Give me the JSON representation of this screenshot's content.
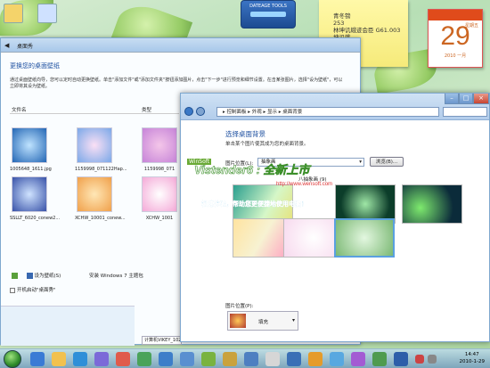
{
  "gadgets": {
    "note_lines": [
      "青冬镑",
      "253",
      "林坤讥蛾迹会臣 G61.003",
      "坤讥蛾",
      "57CAG"
    ],
    "calendar": {
      "weekday": "星期五",
      "day": "29",
      "year_month": "2010 一月"
    },
    "meter_label": "DATEAGE TOOLS"
  },
  "back_window": {
    "title": "桌面秀",
    "subtitle": "更换您的桌面壁纸",
    "description": "通过桌面壁纸向导，您可以定时自动更换壁纸。单击\"添加文件\"或\"添加文件夹\"按钮添加图片，点击\"下一步\"进行预览和细节设置。在击某张图片，选择\"设为壁纸\"，可以立即将其设为壁纸。",
    "columns": [
      "文件名",
      "类型"
    ],
    "files_row1": [
      "1005648_1611.jpg",
      "1159998_071122Hap...",
      "1159998_071"
    ],
    "files_row2": [
      "SSLLT_6020_conew2...",
      "XCHW_10001_conew...",
      "XCHW_1001"
    ],
    "set_wallpaper": "设为壁纸(S)",
    "install_theme": "安装 Windows 7 主题包",
    "autostart": "开机启动\"桌面秀\""
  },
  "front_window": {
    "breadcrumb": "▸ 控制面板 ▸ 外观 ▸ 显示 ▸ 桌面背景",
    "heading": "选择桌面背景",
    "subheading": "单击某个图片使其成为您的桌面背景。",
    "location_label": "图片位置(L):",
    "location_value": "抽象画",
    "browse": "浏览(B)...",
    "group_label": "八抽象画 (9)",
    "position_label": "图片位置(P):",
    "position_value": "填充"
  },
  "overlay": {
    "brand": "WinSoft",
    "title": "Vistender6 : 全新上市",
    "url": "http://www.wensoft.com",
    "slogan": "极速体验，帮助您更便捷地使用电脑！"
  },
  "taskbar": {
    "time": "14:47",
    "date": "2010-1-29",
    "ime_text": "计算机VIKEY_1025"
  }
}
